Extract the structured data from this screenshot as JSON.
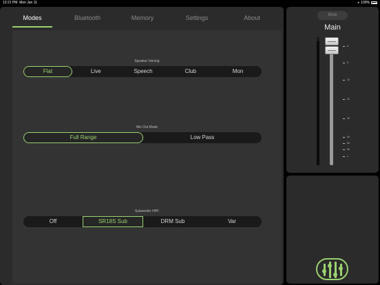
{
  "status_bar": {
    "time": "12:21 PM",
    "date": "Mon Jan 11",
    "battery": "100%"
  },
  "tabs": [
    {
      "label": "Modes",
      "active": true
    },
    {
      "label": "Bluetooth",
      "active": false
    },
    {
      "label": "Memory",
      "active": false
    },
    {
      "label": "Settings",
      "active": false
    },
    {
      "label": "About",
      "active": false
    }
  ],
  "speaker_voicing": {
    "title": "Speaker Voicing",
    "options": [
      "Flat",
      "Live",
      "Speech",
      "Club",
      "Mon"
    ],
    "selected": "Flat"
  },
  "mix_out_mode": {
    "title": "Mix Out Mode",
    "options": [
      "Full Range",
      "Low Pass"
    ],
    "selected": "Full Range"
  },
  "subwoofer_hpf": {
    "title": "Subwoofer HPF",
    "options": [
      "Off",
      "SR18S Sub",
      "DRM Sub",
      "Var"
    ],
    "selected": "SR18S Sub"
  },
  "channel": {
    "mute_label": "Mute",
    "name": "Main",
    "scale": [
      "U",
      "5",
      "10",
      "20",
      "30",
      "40",
      "50",
      "60",
      "∞"
    ]
  },
  "colors": {
    "accent": "#9bd270",
    "panel": "#2b2b2b",
    "content": "#333333",
    "segment": "#1a1a1a"
  },
  "icons": {
    "signal": "wifi-icon",
    "battery": "battery-icon",
    "logo": "mixer-faders-logo-icon"
  }
}
